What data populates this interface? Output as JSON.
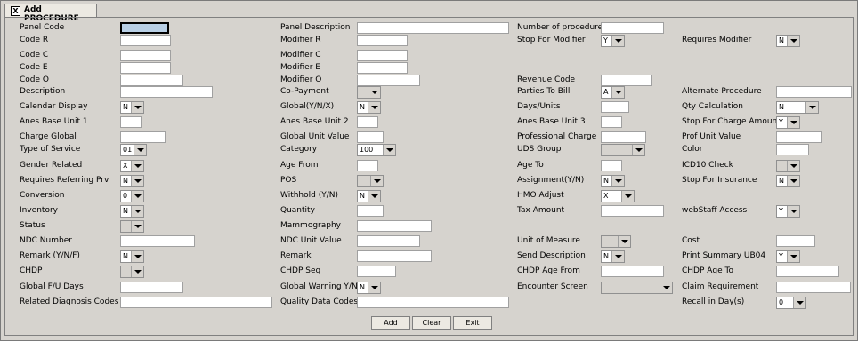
{
  "tab": {
    "title": "Add PROCEDURE",
    "close_glyph": "X"
  },
  "fields": {
    "panel_code": "Panel Code",
    "panel_description": "Panel Description",
    "number_of_procedure": "Number of procedure",
    "code_r": "Code R",
    "modifier_r": "Modifier R",
    "stop_for_modifier": {
      "label": "Stop For Modifier",
      "value": "Y"
    },
    "requires_modifier": {
      "label": "Requires Modifier",
      "value": "N"
    },
    "code_c": "Code C",
    "modifier_c": "Modifier C",
    "code_e": "Code E",
    "modifier_e": "Modifier E",
    "code_o": "Code O",
    "modifier_o": "Modifier O",
    "revenue_code": "Revenue Code",
    "description": "Description",
    "co_payment": {
      "label": "Co-Payment",
      "value": ""
    },
    "parties_to_bill": {
      "label": "Parties To Bill",
      "value": "A"
    },
    "alternate_procedure": "Alternate Procedure",
    "calendar_display": {
      "label": "Calendar Display",
      "value": "N"
    },
    "global_ynx": {
      "label": "Global(Y/N/X)",
      "value": "N"
    },
    "days_units": "Days/Units",
    "qty_calculation": {
      "label": "Qty Calculation",
      "value": "N"
    },
    "anes_base_unit_1": "Anes Base Unit 1",
    "anes_base_unit_2": "Anes Base Unit 2",
    "anes_base_unit_3": "Anes Base Unit 3",
    "stop_for_charge_amount": {
      "label": "Stop For Charge Amount",
      "value": "Y"
    },
    "charge_global": "Charge Global",
    "global_unit_value": "Global Unit Value",
    "professional_charge": "Professional Charge",
    "prof_unit_value": "Prof Unit Value",
    "type_of_service": {
      "label": "Type of Service",
      "value": "01"
    },
    "category": {
      "label": "Category",
      "value": "100"
    },
    "uds_group": {
      "label": "UDS Group",
      "value": ""
    },
    "color": "Color",
    "gender_related": {
      "label": "Gender Related",
      "value": "X"
    },
    "age_from": "Age From",
    "age_to": "Age To",
    "icd10_check": {
      "label": "ICD10 Check",
      "value": ""
    },
    "requires_referring_prv": {
      "label": "Requires Referring Prv",
      "value": "N"
    },
    "pos": {
      "label": "POS",
      "value": ""
    },
    "assignment_yn": {
      "label": "Assignment(Y/N)",
      "value": "N"
    },
    "stop_for_insurance": {
      "label": "Stop For Insurance",
      "value": "N"
    },
    "conversion": {
      "label": "Conversion",
      "value": "0"
    },
    "withhold_yn": {
      "label": "Withhold (Y/N)",
      "value": "N"
    },
    "hmo_adjust": {
      "label": "HMO Adjust",
      "value": "X"
    },
    "inventory": {
      "label": "Inventory",
      "value": "N"
    },
    "quantity": "Quantity",
    "tax_amount": "Tax Amount",
    "webstaff_access": {
      "label": "webStaff Access",
      "value": "Y"
    },
    "status": {
      "label": "Status",
      "value": ""
    },
    "mammography": "Mammography",
    "ndc_number": "NDC Number",
    "ndc_unit_value": "NDC Unit Value",
    "unit_of_measure": {
      "label": "Unit of Measure",
      "value": ""
    },
    "cost": "Cost",
    "remark_ynf": {
      "label": "Remark (Y/N/F)",
      "value": "N"
    },
    "remark": "Remark",
    "send_description": {
      "label": "Send Description",
      "value": "N"
    },
    "print_summary_ub04": {
      "label": "Print Summary UB04",
      "value": "Y"
    },
    "chdp": {
      "label": "CHDP",
      "value": ""
    },
    "chdp_seq": "CHDP Seq",
    "chdp_age_from": "CHDP Age From",
    "chdp_age_to": "CHDP Age To",
    "global_fu_days": "Global F/U Days",
    "global_warning_yn": {
      "label": "Global Warning Y/N",
      "value": "N"
    },
    "encounter_screen": {
      "label": "Encounter Screen",
      "value": ""
    },
    "claim_requirement": "Claim Requirement",
    "related_diagnosis_codes": "Related Diagnosis Codes",
    "quality_data_codes": "Quality Data Codes",
    "recall_in_days": {
      "label": "Recall in Day(s)",
      "value": "0"
    }
  },
  "buttons": {
    "add": "Add",
    "clear": "Clear",
    "exit": "Exit"
  }
}
